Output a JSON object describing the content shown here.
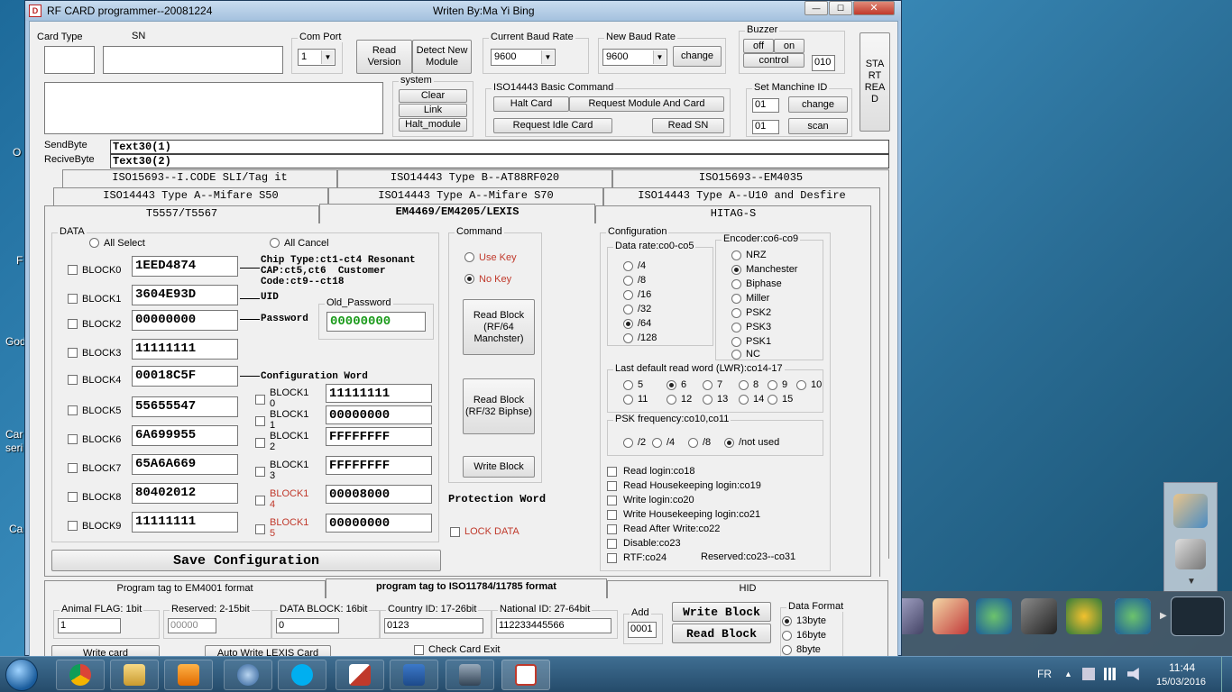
{
  "desktop": {
    "left_labels": [
      "O",
      "F",
      "God",
      "Car",
      "seri",
      "Ca"
    ]
  },
  "window": {
    "title": "RF CARD programmer--20081224",
    "author": "Writen By:Ma Yi Bing",
    "controls": {
      "min": "—",
      "max": "☐",
      "close": "✕"
    }
  },
  "top": {
    "card_type_label": "Card Type",
    "sn_label": "SN",
    "card_type_value": "",
    "sn_value": "",
    "com_port_group": "Com Port",
    "com_port_value": "1",
    "read_version": "Read\nVersion",
    "detect_module": "Detect New\nModule",
    "current_baud_group": "Current Baud Rate",
    "current_baud_value": "9600",
    "new_baud_group": "New Baud Rate",
    "new_baud_value": "9600",
    "change": "change",
    "buzzer_group": "Buzzer",
    "buzzer_off": "off",
    "buzzer_on": "on",
    "buzzer_control": "control",
    "buzzer_value": "010",
    "start_read": "STA\nRT\nREA\nD"
  },
  "system": {
    "group": "system",
    "clear": "Clear",
    "link": "Link",
    "halt_module": "Halt_module",
    "log_text": ""
  },
  "iso14443_basic": {
    "group": "ISO14443 Basic Command",
    "halt_card": "Halt Card",
    "request_module_card": "Request Module And Card",
    "request_idle_card": "Request Idle Card",
    "read_sn": "Read SN"
  },
  "machine_id": {
    "group": "Set Manchine ID",
    "id1": "01",
    "id2": "01",
    "change": "change",
    "scan": "scan"
  },
  "bytes": {
    "send_label": "SendByte",
    "receive_label": "ReciveByte",
    "send_value": "Text30(1)",
    "receive_value": "Text30(2)"
  },
  "tabs": {
    "row1": [
      "ISO15693--I.CODE SLI/Tag it",
      "ISO14443 Type B--AT88RF020",
      "ISO15693--EM4035"
    ],
    "row2": [
      "ISO14443 Type A--Mifare S50",
      "ISO14443 Type A--Mifare S70",
      "ISO14443 Type A--U10 and Desfire"
    ],
    "row3": [
      "T5557/T5567",
      "EM4469/EM4205/LEXIS",
      "HITAG-S"
    ]
  },
  "data_group": {
    "group": "DATA",
    "all_select": "All Select",
    "all_cancel": "All Cancel",
    "blocks": [
      {
        "label": "BLOCK0",
        "value": "1EED4874"
      },
      {
        "label": "BLOCK1",
        "value": "3604E93D"
      },
      {
        "label": "BLOCK2",
        "value": "00000000"
      },
      {
        "label": "BLOCK3",
        "value": "11111111"
      },
      {
        "label": "BLOCK4",
        "value": "00018C5F"
      },
      {
        "label": "BLOCK5",
        "value": "55655547"
      },
      {
        "label": "BLOCK6",
        "value": "6A699955"
      },
      {
        "label": "BLOCK7",
        "value": "65A6A669"
      },
      {
        "label": "BLOCK8",
        "value": "80402012"
      },
      {
        "label": "BLOCK9",
        "value": "11111111"
      }
    ],
    "blocks_right": [
      {
        "label": "BLOCK1\n0",
        "value": "11111111"
      },
      {
        "label": "BLOCK1\n1",
        "value": "00000000"
      },
      {
        "label": "BLOCK1\n2",
        "value": "FFFFFFFF"
      },
      {
        "label": "BLOCK1\n3",
        "value": "FFFFFFFF"
      },
      {
        "label": "BLOCK1\n4",
        "value": "00008000"
      },
      {
        "label": "BLOCK1\n5",
        "value": "00000000"
      }
    ],
    "annot_chip": "Chip Type:ct1-ct4 Resonant\nCAP:ct5,ct6  Customer\nCode:ct9--ct18",
    "annot_uid": "UID",
    "annot_password": "Password",
    "annot_config": "Configuration Word",
    "old_password_group": "Old_Password",
    "old_password_value": "00000000",
    "save_config": "Save Configuration"
  },
  "command": {
    "group": "Command",
    "use_key": "Use Key",
    "no_key": "No Key",
    "read_block_manchester": "Read Block\n(RF/64\nManchster)",
    "read_block_biphase": "Read Block\n(RF/32 Biphse)",
    "write_block": "Write Block",
    "protection_word": "Protection Word",
    "lock_data": "LOCK DATA"
  },
  "configuration": {
    "group": "Configuration",
    "data_rate_group": "Data rate:co0-co5",
    "data_rates": [
      "/4",
      "/8",
      "/16",
      "/32",
      "/64",
      "/128"
    ],
    "data_rate_selected": "/64",
    "encoder_group": "Encoder:co6-co9",
    "encoders": [
      "NRZ",
      "Manchester",
      "Biphase",
      "Miller",
      "PSK2",
      "PSK3",
      "PSK1",
      "NC"
    ],
    "encoder_selected": "Manchester",
    "lwr_group": "Last default read word (LWR):co14-17",
    "lwr_values": [
      "5",
      "6",
      "7",
      "8",
      "9",
      "10",
      "11",
      "12",
      "13",
      "14",
      "15"
    ],
    "lwr_selected": "6",
    "psk_group": "PSK frequency:co10,co11",
    "psk_values": [
      "/2",
      "/4",
      "/8",
      "/not used"
    ],
    "psk_selected": "/not used",
    "checks": [
      "Read login:co18",
      "Read Housekeeping login:co19",
      "Write login:co20",
      "Write Housekeeping login:co21",
      "Read After Write:co22",
      "Disable:co23",
      "RTF:co24"
    ],
    "reserved": "Reserved:co23--co31"
  },
  "bottom_tabs": [
    "Program tag to EM4001 format",
    "program tag to ISO11784/11785 format",
    "HID"
  ],
  "iso11784": {
    "animal_flag_label": "Animal FLAG: 1bit",
    "animal_flag_value": "1",
    "reserved_label": "Reserved: 2-15bit",
    "reserved_value": "00000",
    "data_block_label": "DATA BLOCK: 16bit",
    "data_block_value": "0",
    "country_label": "Country ID: 17-26bit",
    "country_value": "0123",
    "national_label": "National ID: 27-64bit",
    "national_value": "112233445566",
    "add_group": "Add",
    "add_value": "0001",
    "write_block": "Write Block",
    "read_block": "Read Block",
    "data_format_group": "Data Format",
    "formats": [
      "13byte",
      "16byte",
      "8byte"
    ],
    "format_selected": "13byte",
    "write_card": "Write card",
    "auto_write": "Auto Write LEXIS Card",
    "check_card_exit": "Check Card Exit"
  },
  "taskbar": {
    "apps": [
      "start-orb",
      "chrome",
      "explorer",
      "media-player",
      "thunderbird",
      "skype",
      "pdf-app",
      "word",
      "network-app",
      "rf-programmer"
    ],
    "language": "FR",
    "time": "11:44",
    "date": "15/03/2016"
  },
  "colors": {
    "accent_red": "#c0392b",
    "old_password_green": "#1a9a1a",
    "title_bar": "#a4c1de"
  }
}
